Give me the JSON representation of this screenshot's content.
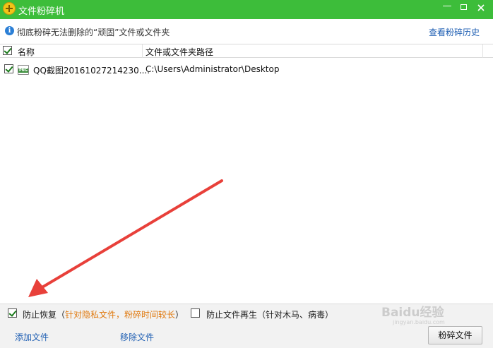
{
  "window": {
    "title": "文件粉碎机",
    "min_glyph": "—"
  },
  "info": {
    "text": "彻底粉碎无法删除的“顽固”文件或文件夹",
    "history_link": "查看粉碎历史"
  },
  "table": {
    "headers": {
      "name": "名称",
      "path": "文件或文件夹路径"
    },
    "rows": [
      {
        "checked": true,
        "icon": "png-file-icon",
        "icon_text": "PNG",
        "name": "QQ截图20161027214230....",
        "path": "C:\\Users\\Administrator\\Desktop"
      }
    ]
  },
  "options": {
    "prevent_recovery": {
      "checked": true,
      "label": "防止恢复（",
      "note": "针对隐私文件，粉碎时间较长",
      "suffix": "）"
    },
    "prevent_regen": {
      "checked": false,
      "label": "防止文件再生（针对木马、病毒）"
    }
  },
  "footer": {
    "add_file": "添加文件",
    "remove_file": "移除文件",
    "shred_button": "粉碎文件"
  },
  "watermark": {
    "text": "Baidu经验",
    "sub": "jingyan.baidu.com"
  },
  "colors": {
    "titlebar": "#3dbd3a",
    "link": "#1f5fb3",
    "note": "#e07a10",
    "arrow": "#e8403a"
  }
}
